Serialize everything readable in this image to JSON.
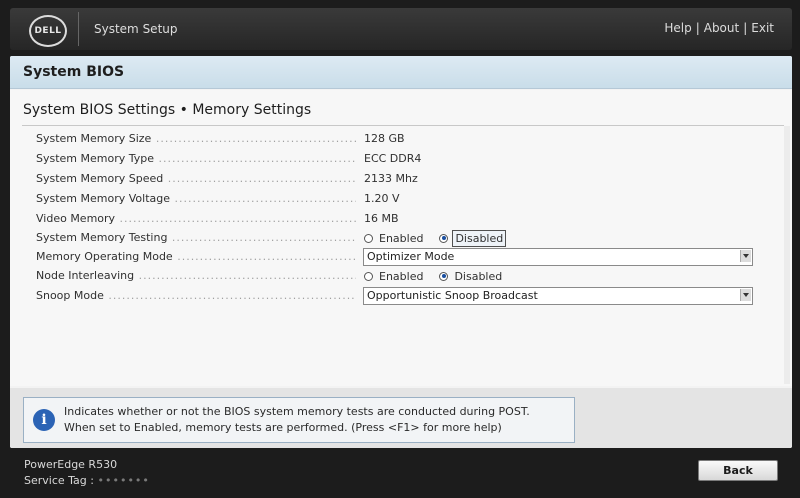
{
  "header": {
    "logo_text": "DELL",
    "app_title": "System Setup",
    "links": [
      "Help",
      "About",
      "Exit"
    ]
  },
  "panel": {
    "title": "System BIOS",
    "section_title": "System BIOS Settings • Memory Settings"
  },
  "settings": {
    "memory_size": {
      "label": "System Memory Size",
      "value": "128 GB"
    },
    "memory_type": {
      "label": "System Memory Type",
      "value": "ECC DDR4"
    },
    "memory_speed": {
      "label": "System Memory Speed",
      "value": "2133 Mhz"
    },
    "memory_voltage": {
      "label": "System Memory Voltage",
      "value": "1.20 V"
    },
    "video_memory": {
      "label": "Video Memory",
      "value": "16 MB"
    },
    "memory_testing": {
      "label": "System Memory Testing",
      "options": [
        "Enabled",
        "Disabled"
      ],
      "selected": "Disabled"
    },
    "operating_mode": {
      "label": "Memory Operating Mode",
      "value": "Optimizer Mode"
    },
    "node_interleaving": {
      "label": "Node Interleaving",
      "options": [
        "Enabled",
        "Disabled"
      ],
      "selected": "Disabled"
    },
    "snoop_mode": {
      "label": "Snoop Mode",
      "value": "Opportunistic Snoop Broadcast"
    }
  },
  "help": {
    "line1": "Indicates whether or not the BIOS system memory tests are conducted during POST.",
    "line2": "When set to Enabled, memory tests are performed. (Press <F1> for more help)"
  },
  "footer": {
    "model": "PowerEdge R530",
    "service_tag_label": "Service Tag :",
    "service_tag_value": "•••••••",
    "back_label": "Back"
  },
  "colors": {
    "accent_blue": "#2b63b5",
    "header_bg": "#c9dde9"
  }
}
